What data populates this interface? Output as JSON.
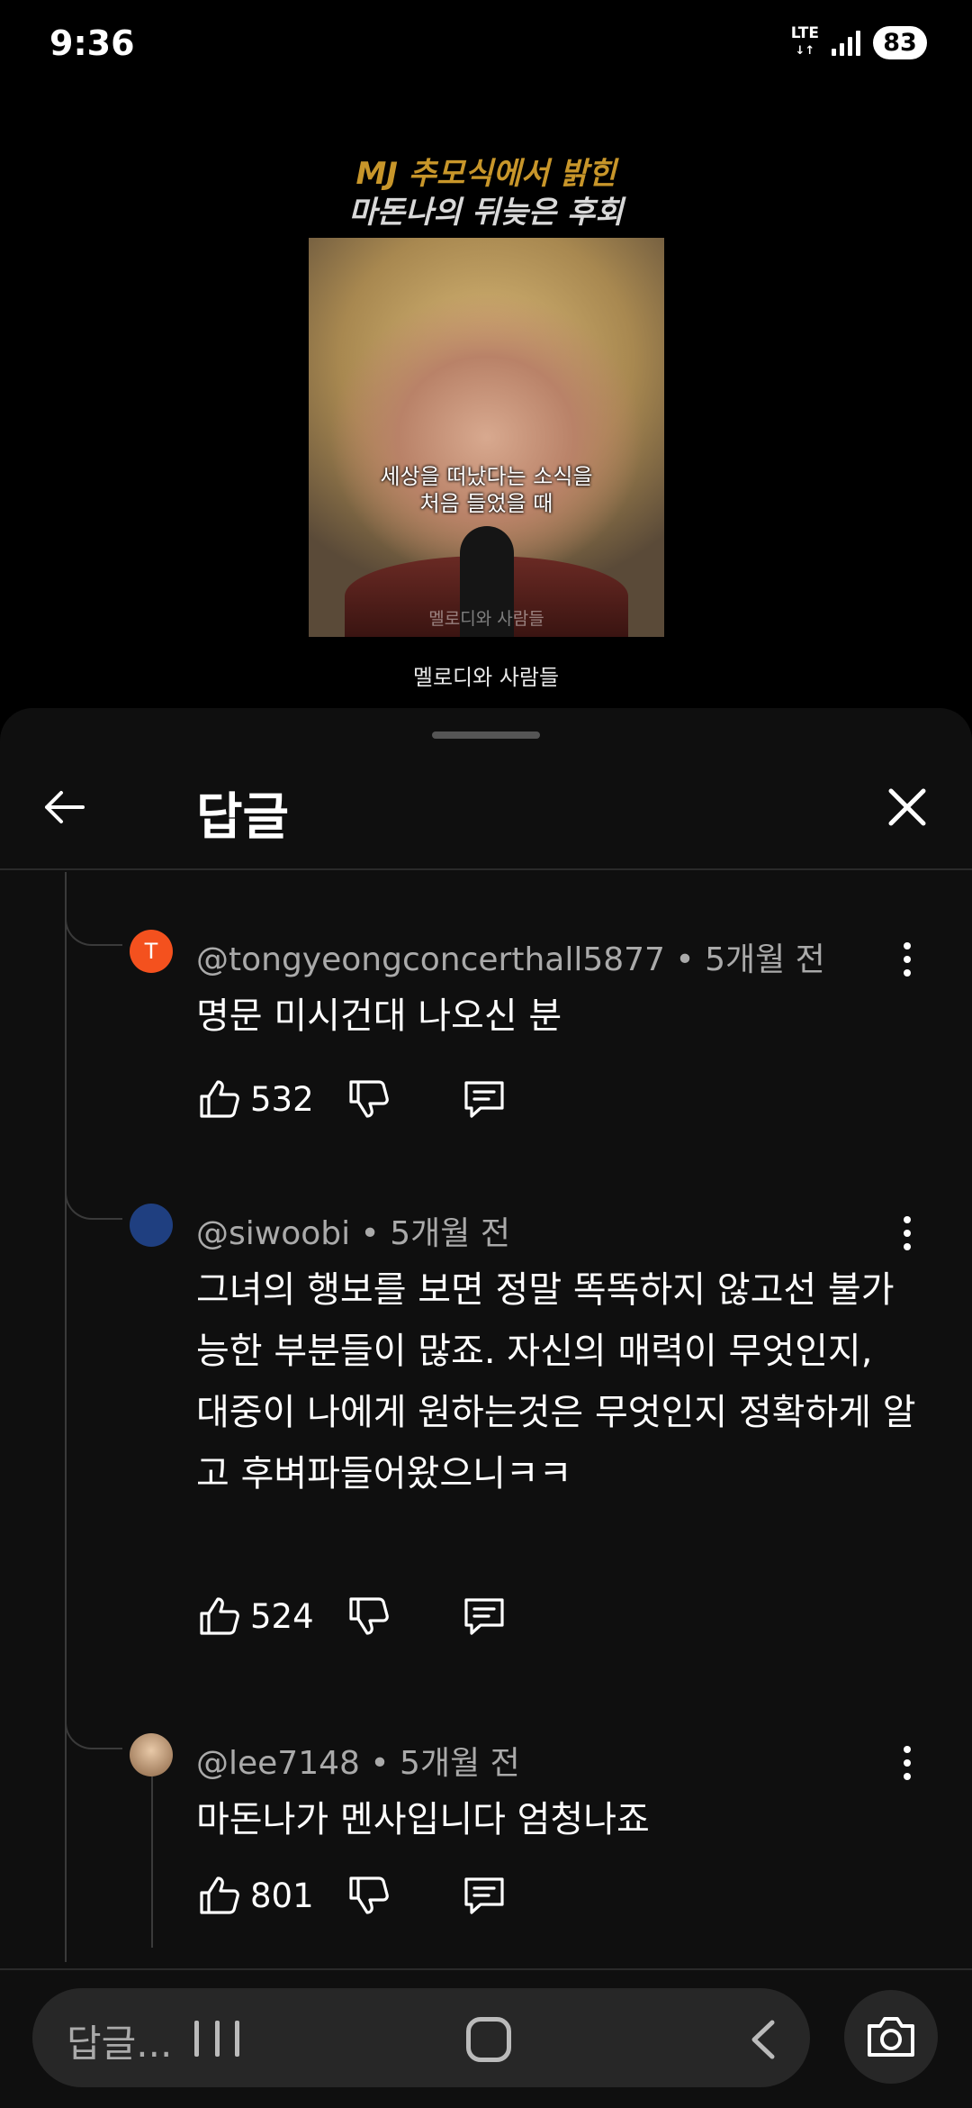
{
  "status": {
    "time": "9:36",
    "network": "LTE",
    "battery": "83"
  },
  "video": {
    "title_line1": "MJ 추모식에서 밝힌",
    "title_line2": "마돈나의 뒤늦은 후회",
    "caption_line1": "세상을 떠났다는 소식을",
    "caption_line2": "처음 들었을 때",
    "watermark": "멜로디와 사람들",
    "channel": "멜로디와 사람들"
  },
  "sheet": {
    "title": "답글"
  },
  "replies": [
    {
      "avatar_letter": "T",
      "avatar_color": "#f4511e",
      "author": "@tongyeongconcerthall5877",
      "time": "5개월 전",
      "text": "명문 미시건대 나오신 분",
      "likes": "532"
    },
    {
      "avatar_letter": "",
      "avatar_color": "#1f3f80",
      "author": "@siwoobi",
      "time": "5개월 전",
      "text": "그녀의 행보를 보면 정말 똑똑하지 않고선 불가능한 부분들이 많죠. 자신의 매력이 무엇인지, 대중이 나에게 원하는것은 무엇인지 정확하게 알고 후벼파들어왔으니ㅋㅋ",
      "likes": "524"
    },
    {
      "avatar_letter": "",
      "avatar_color": "#c9a27a",
      "author": "@lee7148",
      "time": "5개월 전",
      "text": "마돈나가 멘사입니다 엄청나죠",
      "likes": "801"
    }
  ],
  "input": {
    "placeholder": "답글..."
  },
  "icons": {
    "back": "arrow-left-icon",
    "close": "close-icon",
    "like": "thumbs-up-icon",
    "dislike": "thumbs-down-icon",
    "reply": "comment-icon",
    "more": "more-vert-icon",
    "camera": "camera-icon"
  }
}
